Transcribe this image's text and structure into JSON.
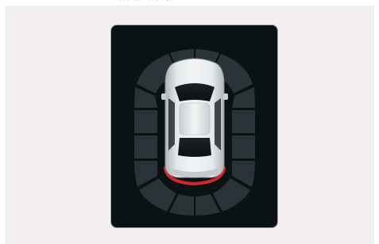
{
  "screen": {
    "background_color": "#f4efef",
    "panel_color": "#0b1214",
    "zone_color": "#2a3438",
    "zone_divider_color": "#0b1214",
    "active_sensor_color": "#d4242c",
    "car_body_color": "#d9dde0"
  },
  "parking_sensors": {
    "front_zones": 6,
    "rear_zones": 6,
    "side_zones_each": 4,
    "active_zone": "rear-center",
    "icons": {
      "vehicle": "car-top-view-icon",
      "sensor_arc": "proximity-arc-icon"
    }
  }
}
